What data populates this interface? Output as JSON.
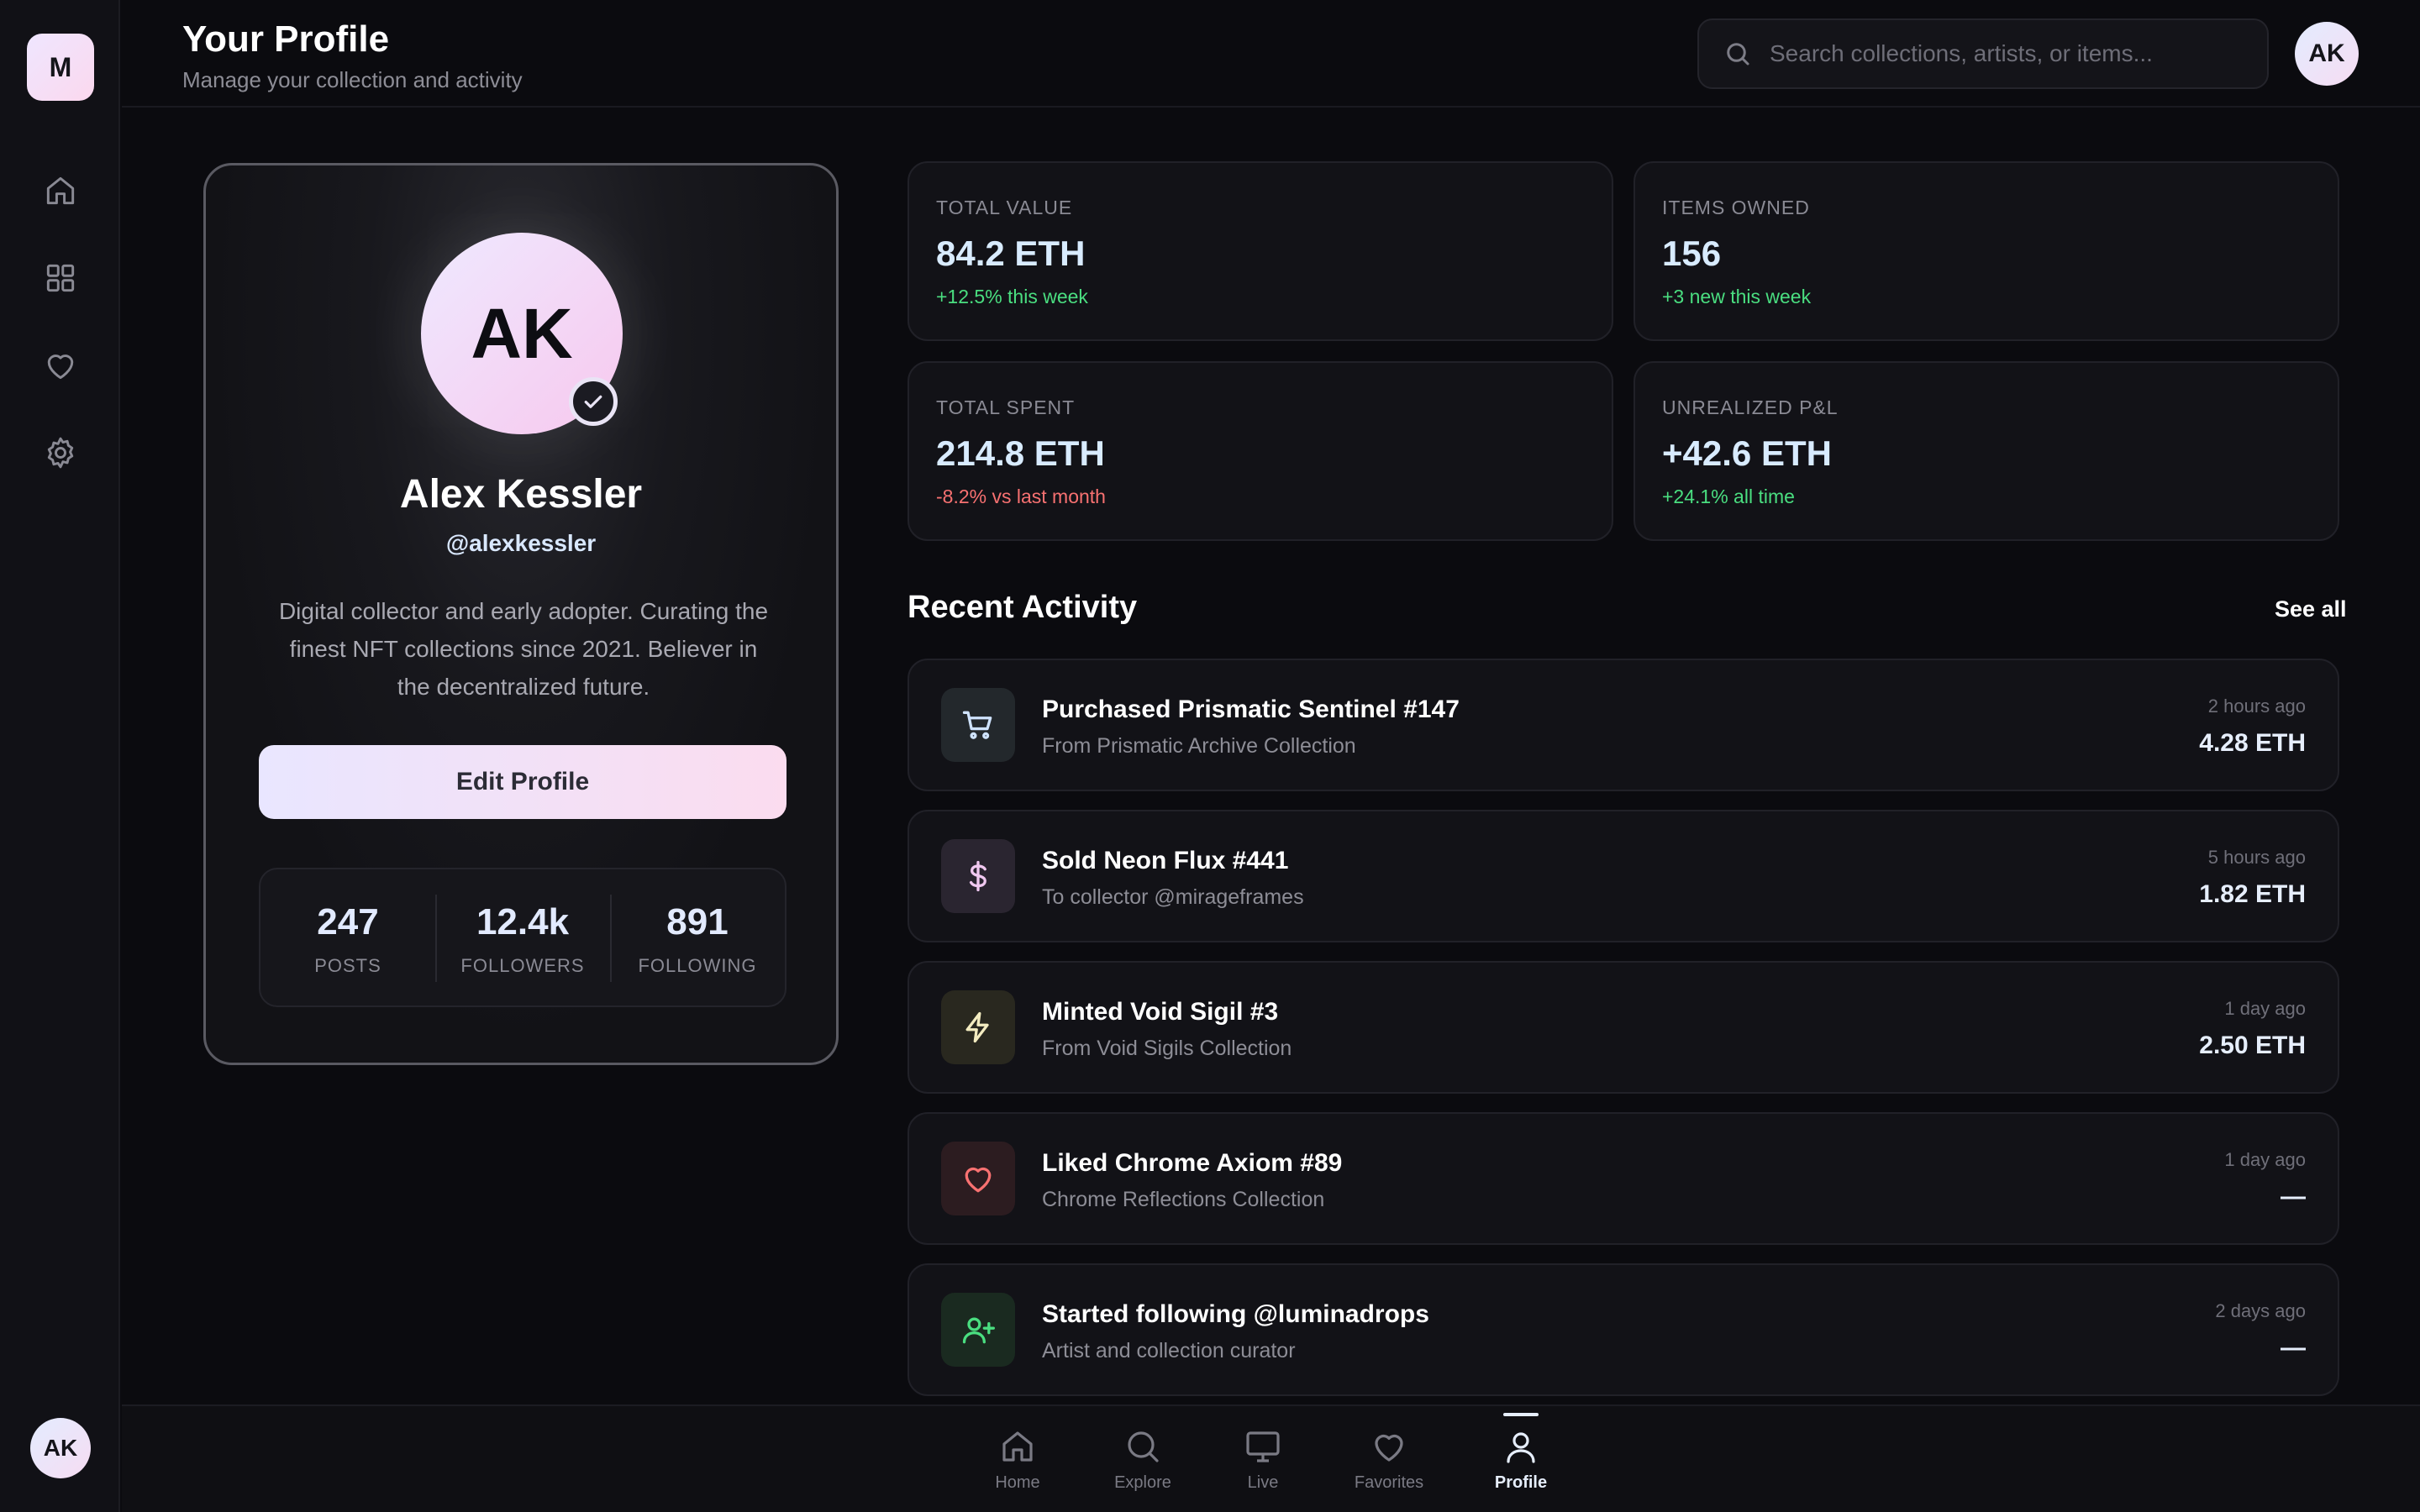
{
  "app": {
    "logo_letter": "M",
    "user_initials": "AK"
  },
  "header": {
    "title": "Your Profile",
    "subtitle": "Manage your collection and activity",
    "search_placeholder": "Search collections, artists, or items..."
  },
  "sidebar": {
    "icons": [
      "home-icon",
      "grid-icon",
      "heart-icon",
      "settings-icon"
    ]
  },
  "profile": {
    "initials": "AK",
    "name": "Alex Kessler",
    "handle": "@alexkessler",
    "bio": "Digital collector and early adopter. Curating the finest NFT collections since 2021. Believer in the decentralized future.",
    "edit_label": "Edit Profile",
    "stats": [
      {
        "value": "247",
        "label": "POSTS"
      },
      {
        "value": "12.4k",
        "label": "FOLLOWERS"
      },
      {
        "value": "891",
        "label": "FOLLOWING"
      }
    ]
  },
  "metrics": [
    {
      "label": "TOTAL VALUE",
      "value": "84.2 ETH",
      "change": "+12.5% this week",
      "trend": "up"
    },
    {
      "label": "ITEMS OWNED",
      "value": "156",
      "change": "+3 new this week",
      "trend": "up"
    },
    {
      "label": "TOTAL SPENT",
      "value": "214.8 ETH",
      "change": "-8.2% vs last month",
      "trend": "down"
    },
    {
      "label": "UNREALIZED P&L",
      "value": "+42.6 ETH",
      "change": "+24.1% all time",
      "trend": "up"
    }
  ],
  "activity": {
    "title": "Recent Activity",
    "see_all": "See all",
    "items": [
      {
        "icon": "cart-icon",
        "title": "Purchased Prismatic Sentinel #147",
        "subtitle": "From Prismatic Archive Collection",
        "time": "2 hours ago",
        "amount": "4.28 ETH"
      },
      {
        "icon": "dollar-icon",
        "title": "Sold Neon Flux #441",
        "subtitle": "To collector @mirageframes",
        "time": "5 hours ago",
        "amount": "1.82 ETH"
      },
      {
        "icon": "bolt-icon",
        "title": "Minted Void Sigil #3",
        "subtitle": "From Void Sigils Collection",
        "time": "1 day ago",
        "amount": "2.50 ETH"
      },
      {
        "icon": "heart-icon",
        "title": "Liked Chrome Axiom #89",
        "subtitle": "Chrome Reflections Collection",
        "time": "1 day ago",
        "amount": "—"
      },
      {
        "icon": "user-plus-icon",
        "title": "Started following @luminadrops",
        "subtitle": "Artist and collection curator",
        "time": "2 days ago",
        "amount": "—"
      }
    ]
  },
  "bottom_nav": [
    {
      "icon": "home-icon",
      "label": "Home"
    },
    {
      "icon": "search-icon",
      "label": "Explore"
    },
    {
      "icon": "monitor-icon",
      "label": "Live"
    },
    {
      "icon": "heart-icon",
      "label": "Favorites"
    },
    {
      "icon": "user-icon",
      "label": "Profile",
      "active": true
    }
  ],
  "colors": {
    "positive": "#4ade80",
    "negative": "#f87171",
    "accent_gradient_start": "#e9e6ff",
    "accent_gradient_end": "#fbdcef"
  }
}
